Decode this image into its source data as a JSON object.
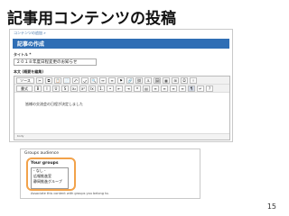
{
  "slide": {
    "title": "記事用コンテンツの投稿",
    "page": "15"
  },
  "editor_screen": {
    "breadcrumb": "コンテンツの追加 »",
    "header": "記事の作成",
    "title_label": "タイトル *",
    "title_value": "２０１８年度日程変更のお知らせ",
    "body_label": "本文 (概要を編集)",
    "toolbar_row1": [
      "ソース",
      "✂",
      "⧉",
      "📋",
      "📄",
      "⤺",
      "⤻",
      "🔍",
      "↔",
      "≡",
      "⚑",
      "🔗",
      "⛓",
      "⚓",
      "🖼",
      "▦",
      "⊞",
      "Ω",
      "⁞"
    ],
    "toolbar_row2_format": "書式",
    "toolbar_row2": [
      "B",
      "I",
      "U",
      "S",
      "x₂",
      "x²",
      "Ix",
      "1.",
      "•",
      "⇤",
      "⇥",
      "❝",
      "▤",
      "≡",
      "≡",
      "≡",
      "≡",
      "¶",
      "↵",
      "?"
    ],
    "body_text": "皆様の交流会の日程が決定しました",
    "status": "body"
  },
  "groups_screen": {
    "heading": "Groups audience",
    "label": "Your groups",
    "options": [
      "- なし -",
      "広報推進室",
      "静岡推進グループ"
    ],
    "description": "Associate this content with groups you belong to."
  }
}
